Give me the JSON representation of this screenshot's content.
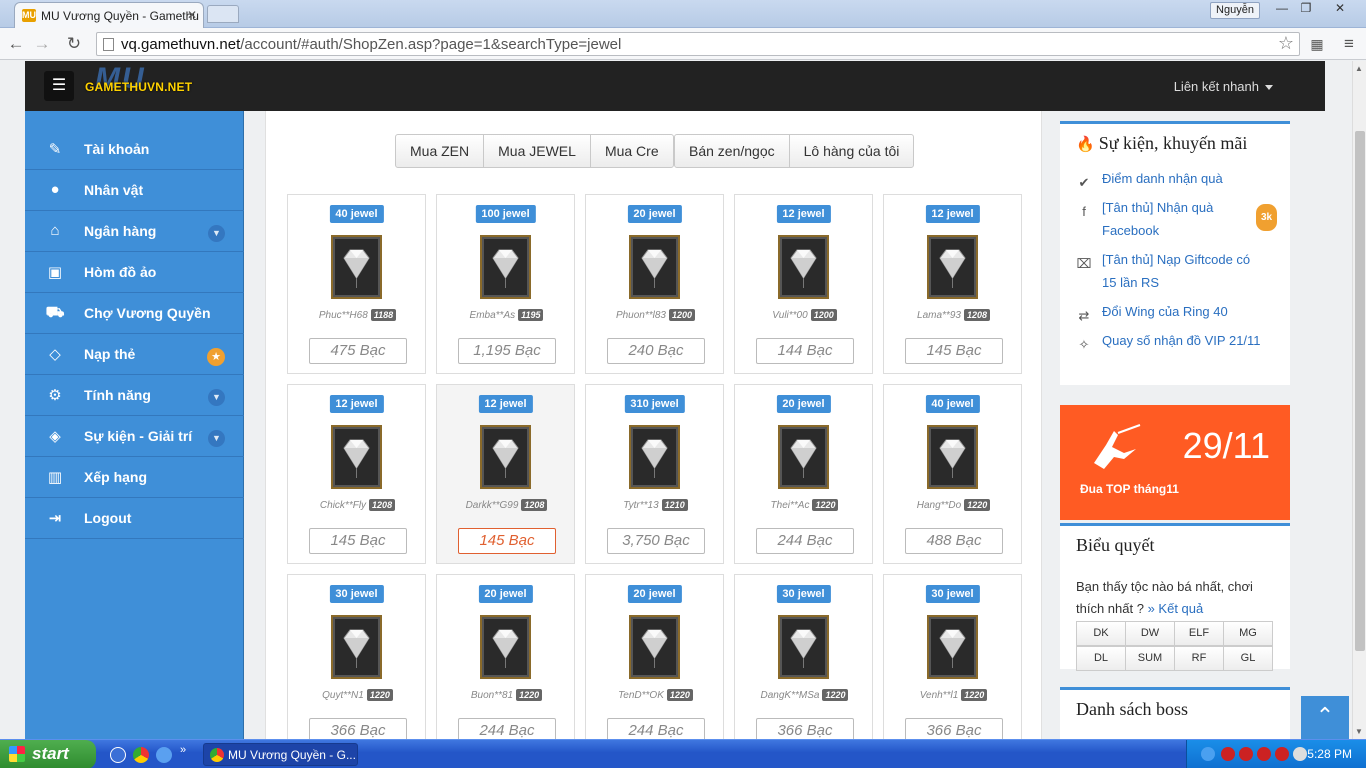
{
  "browser": {
    "tab_title": "MU Vương Quyền - Gamethu",
    "tab_favicon": "MU",
    "user": "Nguyễn",
    "url_host": "vq.gamethuvn.net",
    "url_path": "/account/#auth/ShopZen.asp?page=1&searchType=jewel"
  },
  "header": {
    "logo_text": "GAMETHUVN.NET",
    "logo_mu": "MU",
    "quick_links": "Liên kết nhanh"
  },
  "sidebar": {
    "items": [
      {
        "label": "Tài khoản",
        "icon": "edit-icon"
      },
      {
        "label": "Nhân vật",
        "icon": "user-icon"
      },
      {
        "label": "Ngân hàng",
        "icon": "bank-icon"
      },
      {
        "label": "Hòm đồ ảo",
        "icon": "briefcase-icon"
      },
      {
        "label": "Chợ Vương Quyền",
        "icon": "cart-icon"
      },
      {
        "label": "Nạp thẻ",
        "icon": "diamond-icon"
      },
      {
        "label": "Tính năng",
        "icon": "gears-icon"
      },
      {
        "label": "Sự kiện - Giải trí",
        "icon": "gamepad-icon"
      },
      {
        "label": "Xếp hạng",
        "icon": "bar-chart-icon"
      },
      {
        "label": "Logout",
        "icon": "logout-icon"
      }
    ]
  },
  "shop": {
    "tabs": [
      "Mua ZEN",
      "Mua JEWEL",
      "Mua Cre"
    ],
    "tabs2": [
      "Bán zen/ngọc",
      "Lô hàng của tôi"
    ],
    "cards": [
      {
        "qty": "40 jewel",
        "seller": "Phuc**H68",
        "lvl": "1188",
        "price": "475 Bạc"
      },
      {
        "qty": "100 jewel",
        "seller": "Emba**As",
        "lvl": "1195",
        "price": "1,195 Bạc"
      },
      {
        "qty": "20 jewel",
        "seller": "Phuon**l83",
        "lvl": "1200",
        "price": "240 Bạc"
      },
      {
        "qty": "12 jewel",
        "seller": "Vuli**00",
        "lvl": "1200",
        "price": "144 Bạc"
      },
      {
        "qty": "12 jewel",
        "seller": "Lama**93",
        "lvl": "1208",
        "price": "145 Bạc"
      },
      {
        "qty": "12 jewel",
        "seller": "Chick**Fly",
        "lvl": "1208",
        "price": "145 Bạc"
      },
      {
        "qty": "12 jewel",
        "seller": "Darkk**G99",
        "lvl": "1208",
        "price": "145 Bạc"
      },
      {
        "qty": "310 jewel",
        "seller": "Tytr**13",
        "lvl": "1210",
        "price": "3,750 Bạc"
      },
      {
        "qty": "20 jewel",
        "seller": "Thei**Ac",
        "lvl": "1220",
        "price": "244 Bạc"
      },
      {
        "qty": "40 jewel",
        "seller": "Hang**Do",
        "lvl": "1220",
        "price": "488 Bạc"
      },
      {
        "qty": "30 jewel",
        "seller": "Quyt**N1",
        "lvl": "1220",
        "price": "366 Bạc"
      },
      {
        "qty": "20 jewel",
        "seller": "Buon**81",
        "lvl": "1220",
        "price": "244 Bạc"
      },
      {
        "qty": "20 jewel",
        "seller": "TenD**OK",
        "lvl": "1220",
        "price": "244 Bạc"
      },
      {
        "qty": "30 jewel",
        "seller": "DangK**MSa",
        "lvl": "1220",
        "price": "366 Bạc"
      },
      {
        "qty": "30 jewel",
        "seller": "Venh**l1",
        "lvl": "1220",
        "price": "366 Bạc"
      }
    ]
  },
  "events": {
    "title": "Sự kiện, khuyến mãi",
    "items": [
      {
        "label": "Điểm danh nhận quà",
        "icon": "check-circle-icon"
      },
      {
        "label": "[Tân thủ] Nhận quà Facebook",
        "icon": "facebook-icon",
        "badge": "3k"
      },
      {
        "label": "[Tân thủ] Nạp Giftcode có 15 lần RS",
        "icon": "gift-icon"
      },
      {
        "label": "Đổi Wing của Ring 40",
        "icon": "exchange-icon"
      },
      {
        "label": "Quay số nhận đồ VIP 21/11",
        "icon": "wand-icon"
      }
    ]
  },
  "promo": {
    "date": "29/11",
    "caption": "Đua TOP tháng11"
  },
  "poll": {
    "title": "Biểu quyết",
    "question": "Bạn thấy tộc nào bá nhất, chơi thích nhất ?",
    "result_link": "» Kết quả",
    "options": [
      "DK",
      "DW",
      "ELF",
      "MG",
      "DL",
      "SUM",
      "RF",
      "GL"
    ]
  },
  "boss": {
    "title": "Danh sách boss"
  },
  "taskbar": {
    "start": "start",
    "window": "MU Vương Quyền - G...",
    "clock": "5:28 PM"
  },
  "colors": {
    "accent": "#3f8fd8",
    "promo": "#ff5b23",
    "nav": "#222222"
  }
}
